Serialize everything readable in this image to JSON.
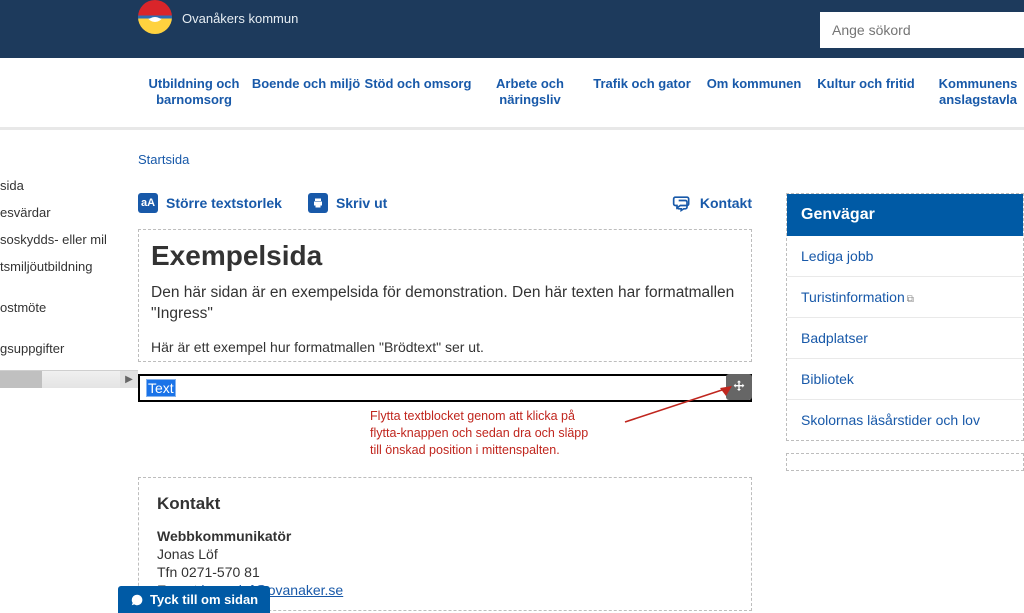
{
  "header": {
    "subtitle": "Ovanåkers kommun",
    "search_placeholder": "Ange sökord"
  },
  "nav": {
    "items": [
      "Utbildning och barnomsorg",
      "Boende och miljö",
      "Stöd och omsorg",
      "Arbete och näringsliv",
      "Trafik och gator",
      "Om kommunen",
      "Kultur och fritid",
      "Kommunens anslagstavla"
    ]
  },
  "left_tree": {
    "items": [
      "sida",
      "esvärdar",
      "soskydds- eller mil",
      "tsmiljöutbildning",
      "",
      "ostmöte",
      "",
      "gsuppgifter"
    ]
  },
  "breadcrumb": "Startsida",
  "toolbar": {
    "textsize": "Större textstorlek",
    "print": "Skriv ut",
    "contact": "Kontakt"
  },
  "article": {
    "title": "Exempelsida",
    "ingress": "Den här sidan är en exempelsida för demonstration. Den här texten har formatmallen \"Ingress\"",
    "body": "Här är ett exempel hur formatmallen \"Brödtext\" ser ut.",
    "text_block_label": "Text"
  },
  "annotation": {
    "line1": "Flytta textblocket genom att klicka på",
    "line2": "flytta-knappen och sedan dra och släpp",
    "line3": "till önskad position i mittenspalten."
  },
  "contact_box": {
    "heading": "Kontakt",
    "role": "Webbkommunikatör",
    "name": "Jonas Löf",
    "phone": "Tfn 0271-570 81",
    "email_prefix": "E-post ",
    "email": "jonas.lof@ovanaker.se"
  },
  "shortcuts": {
    "heading": "Genvägar",
    "items": [
      "Lediga jobb",
      "Turistinformation",
      "Badplatser",
      "Bibliotek",
      "Skolornas läsårstider och lov"
    ],
    "external_index": 1
  },
  "feedback_button": "Tyck till om sidan"
}
